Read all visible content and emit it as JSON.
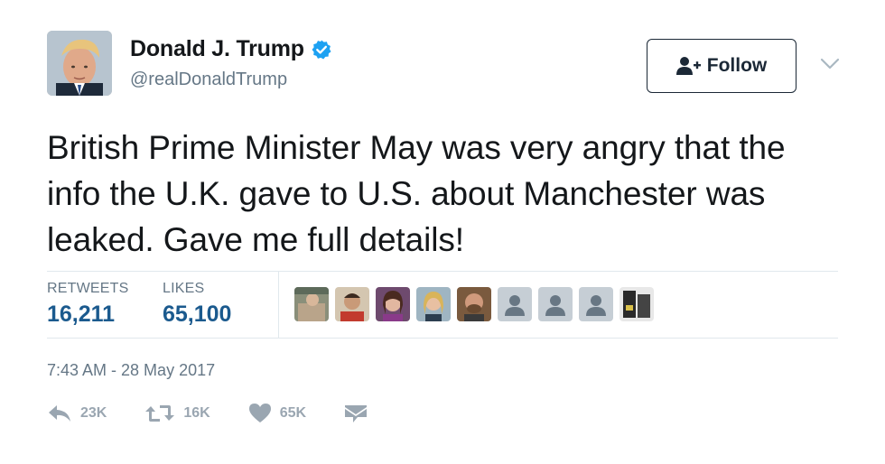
{
  "user": {
    "display_name": "Donald J. Trump",
    "handle": "@realDonaldTrump",
    "verified": true
  },
  "follow_button": {
    "label": "Follow"
  },
  "tweet": {
    "text": "British Prime Minister May was very angry that the info the U.K. gave to U.S. about Manchester was leaked. Gave me full details!"
  },
  "stats": {
    "retweets_label": "RETWEETS",
    "retweets_value": "16,211",
    "likes_label": "LIKES",
    "likes_value": "65,100"
  },
  "timestamp": "7:43 AM - 28 May 2017",
  "actions": {
    "reply_count": "23K",
    "retweet_count": "16K",
    "like_count": "65K"
  },
  "colors": {
    "stat_value": "#1b5a8e",
    "muted": "#657786",
    "verified": "#1da1f2",
    "action_gray": "#9aa6b1"
  },
  "icons": [
    "verified-badge-icon",
    "follow-person-icon",
    "chevron-down-icon",
    "reply-icon",
    "retweet-icon",
    "heart-icon",
    "direct-message-icon"
  ]
}
